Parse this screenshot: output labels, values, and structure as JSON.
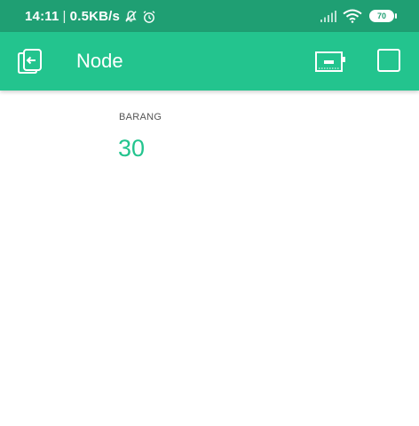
{
  "status_bar": {
    "time": "14:11",
    "separator": "|",
    "network_speed": "0.5KB/s",
    "icons": [
      "mute-bell-icon",
      "alarm-icon",
      "signal-icon",
      "wifi-icon",
      "battery-icon"
    ],
    "battery_level": "70"
  },
  "app_bar": {
    "title": "Node",
    "icons": [
      "back-icon",
      "device-icon",
      "square-icon"
    ]
  },
  "widget": {
    "label": "BARANG",
    "value": "30"
  },
  "colors": {
    "status_bar": "#1f9f73",
    "app_bar": "#23c48e",
    "accent": "#23c48e",
    "background": "#ffffff"
  }
}
